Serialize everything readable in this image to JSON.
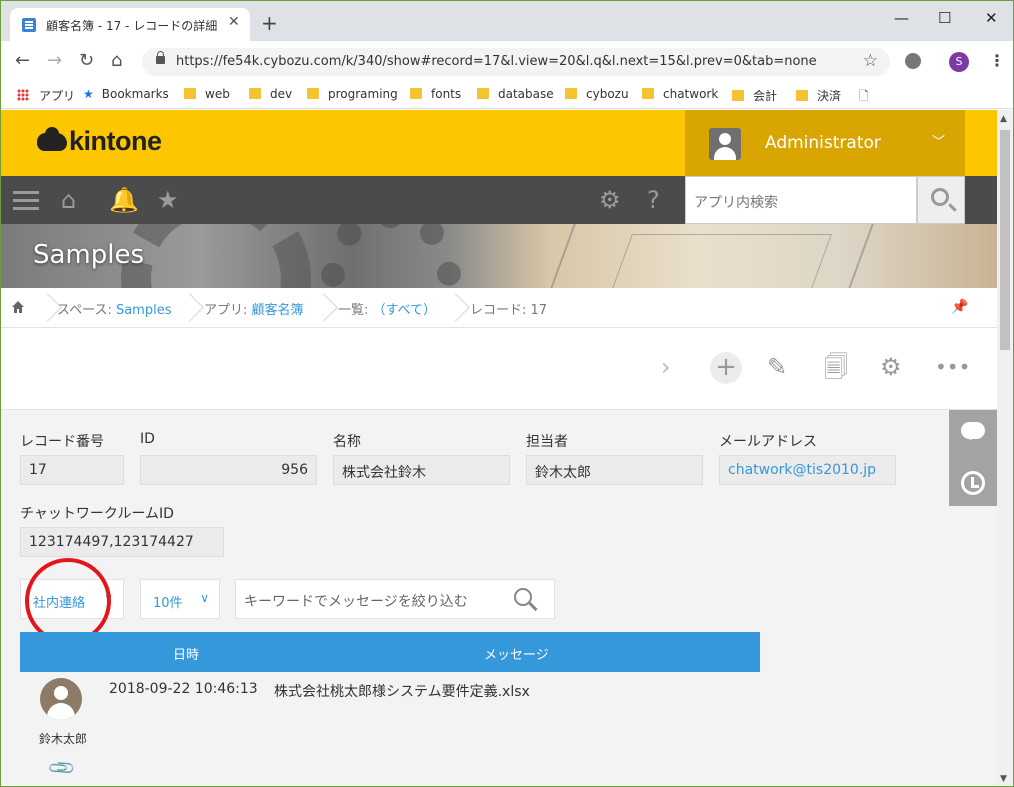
{
  "browser": {
    "tab_title": "顧客名簿 - 17 - レコードの詳細",
    "url": "https://fe54k.cybozu.com/k/340/show#record=17&l.view=20&l.q&l.next=15&l.prev=0&tab=none",
    "profile_initial": "S",
    "bookmarks": [
      "アプリ",
      "Bookmarks",
      "web",
      "dev",
      "programing",
      "fonts",
      "database",
      "cybozu",
      "chatwork",
      "会計",
      "決済"
    ]
  },
  "header": {
    "logo": "kintone",
    "user_name": "Administrator",
    "search_placeholder": "アプリ内検索"
  },
  "banner": {
    "space_title": "Samples"
  },
  "breadcrumb": {
    "space_label": "スペース: ",
    "space_value": "Samples",
    "app_label": "アプリ: ",
    "app_value": "顧客名簿",
    "view_label": "一覧: ",
    "view_value": "（すべて）",
    "record_label": "レコード: 17"
  },
  "fields": {
    "record_no_label": "レコード番号",
    "record_no": "17",
    "id_label": "ID",
    "id": "956",
    "name_label": "名称",
    "name": "株式会社鈴木",
    "owner_label": "担当者",
    "owner": "鈴木太郎",
    "email_label": "メールアドレス",
    "email": "chatwork@tis2010.jp",
    "room_label": "チャットワークルームID",
    "room": "123174497,123174427"
  },
  "filters": {
    "room_select": "社内連絡",
    "count_select": "10件",
    "keyword_placeholder": "キーワードでメッセージを絞り込む"
  },
  "table": {
    "col_time": "日時",
    "col_message": "メッセージ",
    "rows": [
      {
        "user": "鈴木太郎",
        "time": "2018-09-22 10:46:13",
        "message": "株式会社桃太郎様システム要件定義.xlsx"
      }
    ]
  },
  "colors": {
    "header_yellow": "#fdc700",
    "user_box": "#d9a500",
    "nav_dark": "#4b4b4b",
    "accent_blue": "#3498db",
    "annotation_red": "#e2161c"
  }
}
